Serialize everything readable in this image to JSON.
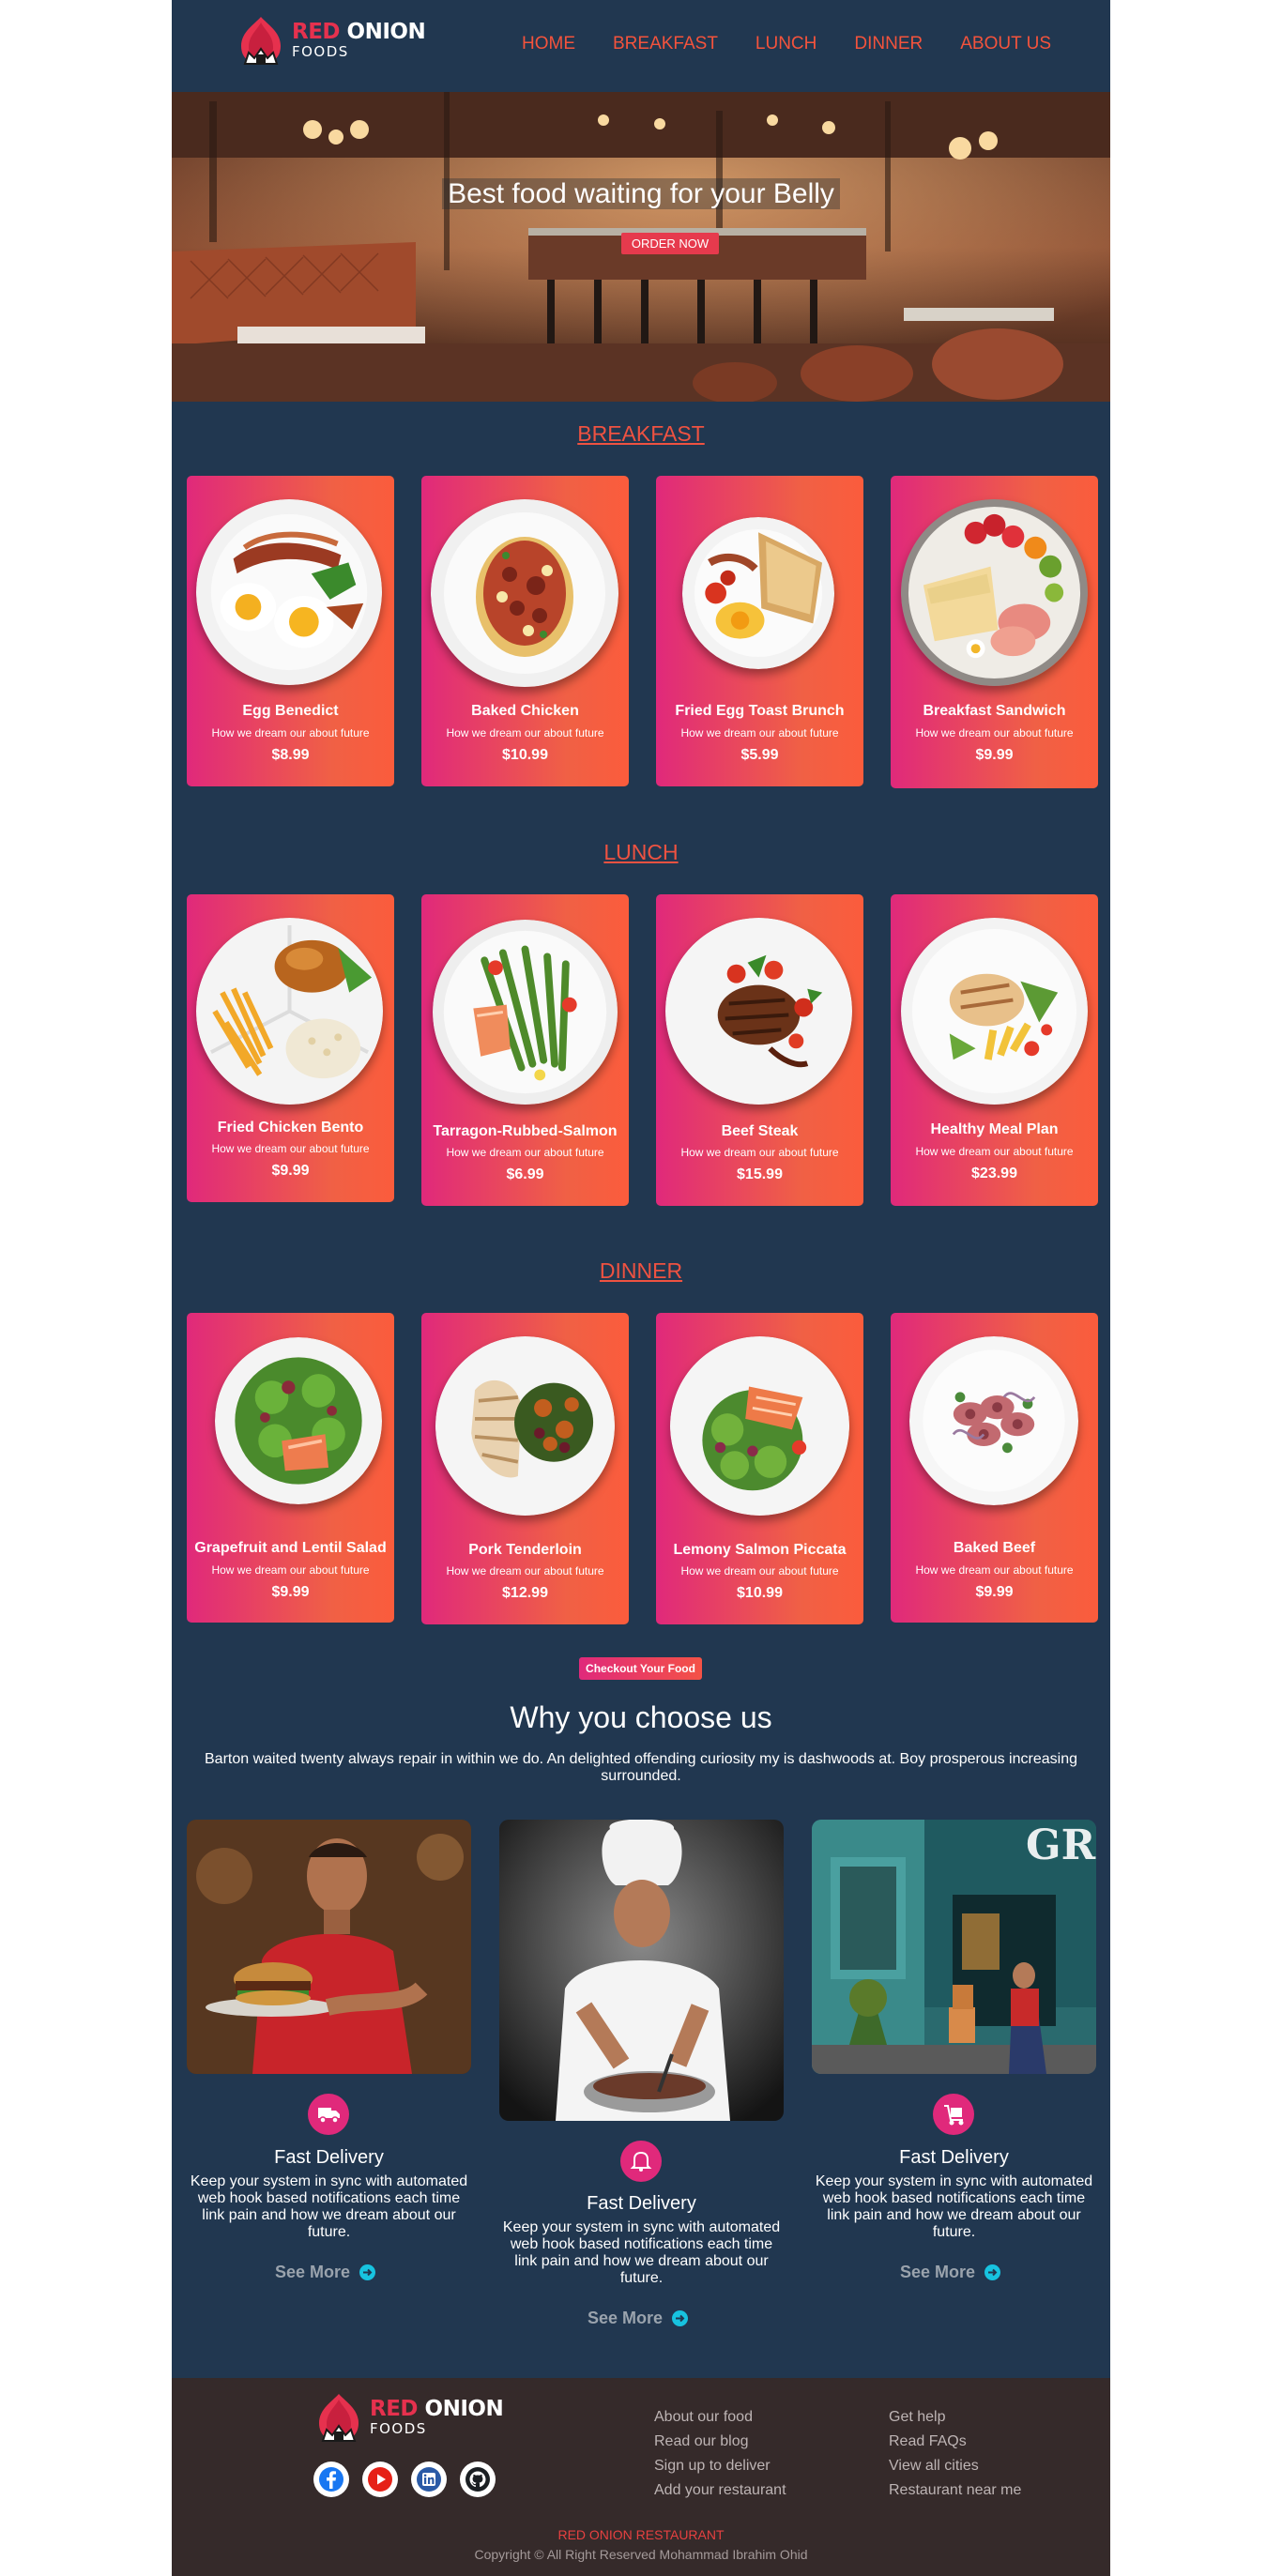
{
  "brand": {
    "name_red": "RED",
    "name_white": "ONION",
    "sub": "FOODS"
  },
  "nav": [
    "HOME",
    "BREAKFAST",
    "LUNCH",
    "DINNER",
    "ABOUT US"
  ],
  "hero": {
    "title": "Best food waiting for your Belly",
    "button": "ORDER NOW"
  },
  "sections": {
    "breakfast": {
      "title": "BREAKFAST",
      "items": [
        {
          "name": "Egg Benedict",
          "desc": "How we dream our about future",
          "price": "$8.99"
        },
        {
          "name": "Baked Chicken",
          "desc": "How we dream our about future",
          "price": "$10.99"
        },
        {
          "name": "Fried Egg Toast Brunch",
          "desc": "How we dream our about future",
          "price": "$5.99"
        },
        {
          "name": "Breakfast Sandwich",
          "desc": "How we dream our about future",
          "price": "$9.99"
        }
      ]
    },
    "lunch": {
      "title": "LUNCH",
      "items": [
        {
          "name": "Fried Chicken Bento",
          "desc": "How we dream our about future",
          "price": "$9.99"
        },
        {
          "name": "Tarragon-Rubbed-Salmon",
          "desc": "How we dream our about future",
          "price": "$6.99"
        },
        {
          "name": "Beef Steak",
          "desc": "How we dream our about future",
          "price": "$15.99"
        },
        {
          "name": "Healthy Meal Plan",
          "desc": "How we dream our about future",
          "price": "$23.99"
        }
      ]
    },
    "dinner": {
      "title": "DINNER",
      "items": [
        {
          "name": "Grapefruit and Lentil Salad",
          "desc": "How we dream our about future",
          "price": "$9.99"
        },
        {
          "name": "Pork Tenderloin",
          "desc": "How we dream our about future",
          "price": "$12.99"
        },
        {
          "name": "Lemony Salmon Piccata",
          "desc": "How we dream our about future",
          "price": "$10.99"
        },
        {
          "name": "Baked Beef",
          "desc": "How we dream our about future",
          "price": "$9.99"
        }
      ]
    }
  },
  "checkout": "Checkout Your Food",
  "why": {
    "title": "Why you choose us",
    "subtitle": "Barton waited twenty always repair in within we do. An delighted offending curiosity my is dashwoods at. Boy prosperous increasing surrounded.",
    "features": [
      {
        "icon": "truck-icon",
        "title": "Fast Delivery",
        "desc": "Keep your system in sync with automated web hook based notifications each time link pain and how we dream about our future.",
        "link": "See More"
      },
      {
        "icon": "bell-icon",
        "title": "Fast Delivery",
        "desc": "Keep your system in sync with automated web hook based notifications each time link pain and how we dream about our future.",
        "link": "See More"
      },
      {
        "icon": "delivery-cart-icon",
        "title": "Fast Delivery",
        "desc": "Keep your system in sync with automated web hook based notifications each time link pain and how we dream about our future.",
        "link": "See More"
      }
    ],
    "storefront_sign": "GR"
  },
  "footer": {
    "links_left": [
      "About our food",
      "Read our blog",
      "Sign up to deliver",
      "Add your restaurant"
    ],
    "links_right": [
      "Get help",
      "Read FAQs",
      "View all cities",
      "Restaurant near me"
    ],
    "social": [
      "facebook-icon",
      "youtube-icon",
      "linkedin-icon",
      "github-icon"
    ],
    "restaurant": "RED ONION RESTAURANT",
    "copyright": "Copyright © All Right Reserved Mohammad Ibrahim Ohid"
  },
  "colors": {
    "page_bg": "#213750",
    "accent": "#f4533c",
    "card_start": "#e0297b",
    "card_end": "#fb5c3c",
    "footer_bg": "#352a2a"
  }
}
